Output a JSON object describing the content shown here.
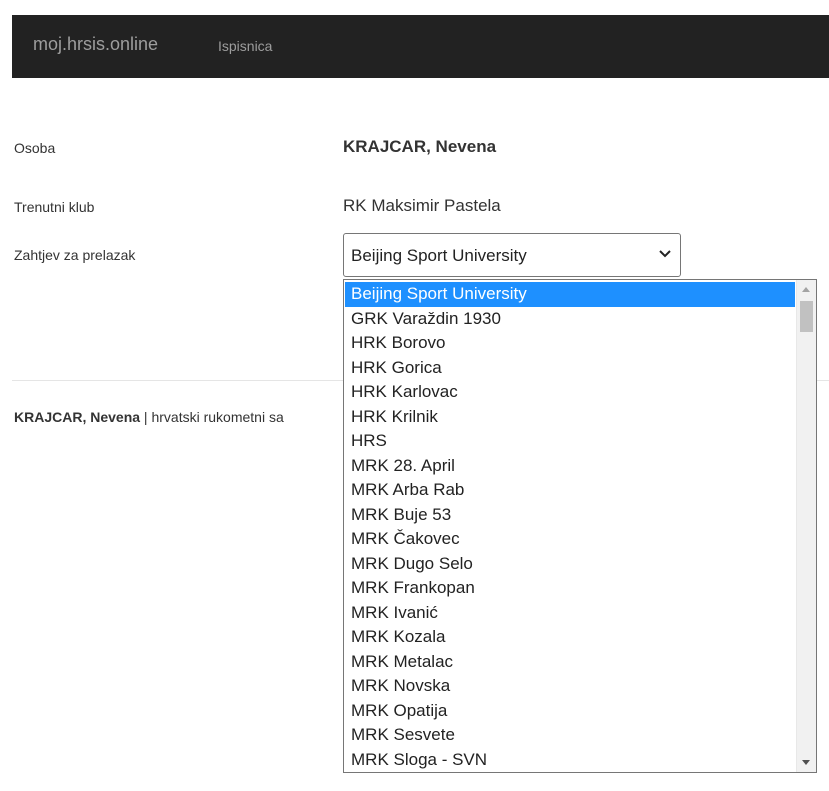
{
  "navbar": {
    "brand": "moj.hrsis.online",
    "link": "Ispisnica"
  },
  "form": {
    "osoba_label": "Osoba",
    "osoba_value": "KRAJCAR, Nevena",
    "klub_label": "Trenutni klub",
    "klub_value": "RK Maksimir Pastela",
    "zahtjev_label": "Zahtjev za prelazak",
    "zahtjev_selected": "Beijing Sport University"
  },
  "footer": {
    "name": "KRAJCAR, Nevena",
    "rest": " | hrvatski rukometni sa"
  },
  "dropdown": {
    "options": [
      "Beijing Sport University",
      "GRK Varaždin 1930",
      "HRK Borovo",
      "HRK Gorica",
      "HRK Karlovac",
      "HRK Krilnik",
      "HRS",
      "MRK 28. April",
      "MRK Arba Rab",
      "MRK Buje 53",
      "MRK Čakovec",
      "MRK Dugo Selo",
      "MRK Frankopan",
      "MRK Ivanić",
      "MRK Kozala",
      "MRK Metalac",
      "MRK Novska",
      "MRK Opatija",
      "MRK Sesvete",
      "MRK Sloga - SVN"
    ],
    "selected_index": 0,
    "highlight_color": "#1e90ff"
  },
  "colors": {
    "navbar_bg": "#222222",
    "navbar_text": "#9d9d9d"
  },
  "icons": {
    "select_arrow": "chevron-down-icon",
    "scroll_up": "scroll-up-arrow-icon",
    "scroll_down": "scroll-down-arrow-icon"
  }
}
